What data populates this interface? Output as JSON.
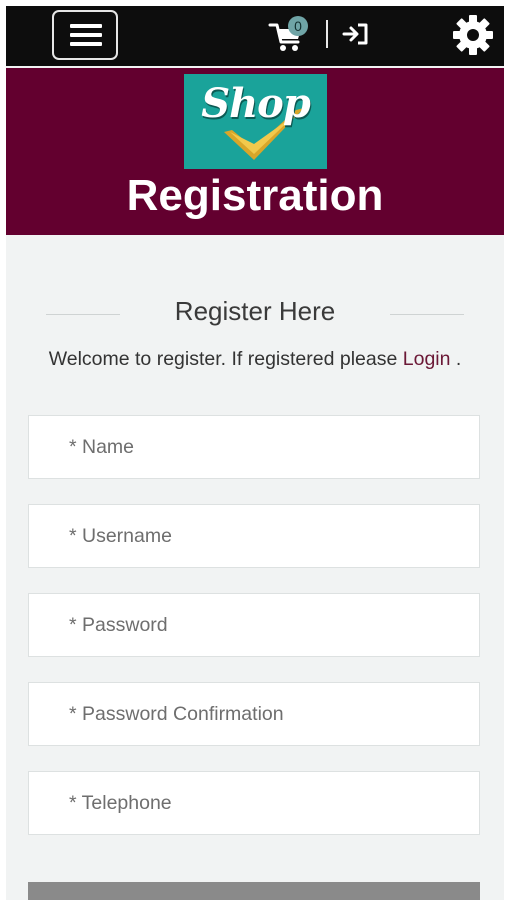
{
  "topbar": {
    "menu_icon": "hamburger-icon",
    "cart_icon": "cart-icon",
    "cart_count": "0",
    "login_icon": "sign-in-icon",
    "settings_icon": "gear-icon"
  },
  "header": {
    "logo_text": "Shop",
    "title": "Registration",
    "background": "#63002f",
    "logo_background": "#1aa39a"
  },
  "form": {
    "section_title": "Register Here",
    "welcome_text": "Welcome to register. If registered please",
    "login_link": "Login",
    "welcome_suffix": " .",
    "fields": [
      {
        "placeholder": "* Name",
        "value": ""
      },
      {
        "placeholder": "* Username",
        "value": ""
      },
      {
        "placeholder": "* Password",
        "value": ""
      },
      {
        "placeholder": "* Password Confirmation",
        "value": ""
      },
      {
        "placeholder": "* Telephone",
        "value": ""
      }
    ]
  }
}
